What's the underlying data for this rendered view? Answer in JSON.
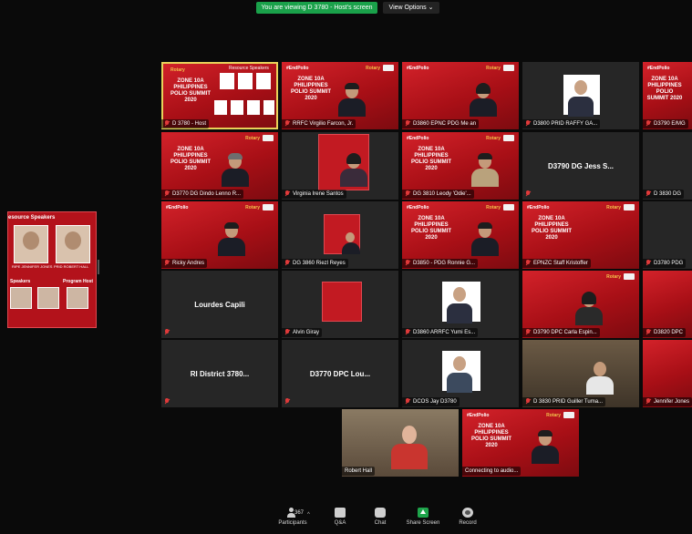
{
  "banner": {
    "viewing_text": "You are viewing D 3780 - Host's screen",
    "view_options": "View Options ⌄"
  },
  "shared_screen": {
    "title": "esource Speakers",
    "speaker_1": "RIPE JENNIFER JONES",
    "speaker_2": "PRID ROBERT HALL",
    "speakers_2": "Speakers",
    "program_host": "Program Host"
  },
  "poster": {
    "hashtag": "#EndPolio",
    "rotary": "Rotary",
    "title": "ZONE 10A PHILIPPINES POLIO SUMMIT 2020",
    "host_title": "ZONE 10A PHILIPPINES POLIO SUMMIT 2020",
    "resource_speakers": "Resource Speakers"
  },
  "tiles": [
    {
      "name": "D 3780 - Host"
    },
    {
      "name": "RRFC Virgilio Farcon, Jr."
    },
    {
      "name": "D3860  EPNC PDG Me an"
    },
    {
      "name": "D3800 PRID RAFFY GA..."
    },
    {
      "name": "D3790 E/MG"
    },
    {
      "name": "D3770 DG Dindo Lenno R..."
    },
    {
      "name": "Virginia Irene Santos"
    },
    {
      "name": "DG 3810 Leody 'Odie'..."
    },
    {
      "name": "D3790 DG Jess S...",
      "big": "D3790 DG Jess S..."
    },
    {
      "name": "D 3830 DG"
    },
    {
      "name": "Ricky Andres"
    },
    {
      "name": "DG 3860 Riezl Reyes"
    },
    {
      "name": "D3850 - PDG Ronnie G..."
    },
    {
      "name": "EPNZC Staff Kristoffer"
    },
    {
      "name": "D3780 PDG"
    },
    {
      "name": "Lourdes Capili",
      "big": "Lourdes Capili"
    },
    {
      "name": "Alvin Giray"
    },
    {
      "name": "D3860 ARRFC Yumi Es..."
    },
    {
      "name": "D3790 DPC Carla Espin..."
    },
    {
      "name": "D3820 DPC"
    },
    {
      "name": "RI District 3780...",
      "big": "RI District 3780..."
    },
    {
      "name": "D3770 DPC Lou...",
      "big": "D3770 DPC Lou..."
    },
    {
      "name": "DCOS Jay D3780"
    },
    {
      "name": "D 3830 PRID Guiller Tuma..."
    },
    {
      "name": "Jennifer Jones"
    },
    {
      "name": "Robert Hall"
    },
    {
      "name": "Connecting to audio..."
    }
  ],
  "toolbar": {
    "participants_count": "367",
    "participants": "Participants",
    "qa": "Q&A",
    "chat": "Chat",
    "share": "Share Screen",
    "record": "Record"
  },
  "colors": {
    "accent_green": "#1aa14a",
    "poster_red": "#c21a22",
    "host_outline": "#e8d25a"
  }
}
